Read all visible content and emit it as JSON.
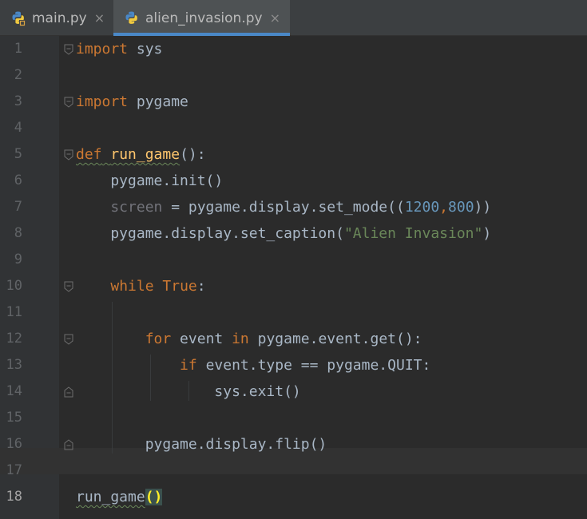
{
  "tabs": [
    {
      "label": "main.py",
      "close": "×",
      "icon": "python-file-icon",
      "active": false
    },
    {
      "label": "alien_invasion.py",
      "close": "×",
      "icon": "python-file-icon",
      "active": true
    }
  ],
  "colors": {
    "background": "#2b2b2b",
    "keyword": "#cc7832",
    "function": "#ffc66d",
    "number": "#6897bb",
    "string": "#6a8759",
    "default_text": "#a9b7c6",
    "active_tab_underline": "#4a88c7"
  },
  "current_line": 18,
  "lines": [
    {
      "num": "1",
      "tokens": [
        {
          "t": "kw",
          "v": "import"
        },
        {
          "t": "plain",
          "v": " sys"
        }
      ]
    },
    {
      "num": "2",
      "tokens": []
    },
    {
      "num": "3",
      "tokens": [
        {
          "t": "kw",
          "v": "import"
        },
        {
          "t": "plain",
          "v": " pygame"
        }
      ]
    },
    {
      "num": "4",
      "tokens": []
    },
    {
      "num": "5",
      "tokens": [
        {
          "t": "kw",
          "v": "def"
        },
        {
          "t": "plain",
          "v": " "
        },
        {
          "t": "fn",
          "v": "run_game"
        },
        {
          "t": "plain",
          "v": "():"
        }
      ]
    },
    {
      "num": "6",
      "tokens": [
        {
          "t": "plain",
          "v": "    pygame.init()"
        }
      ]
    },
    {
      "num": "7",
      "tokens": [
        {
          "t": "unused",
          "v": "    screen"
        },
        {
          "t": "plain",
          "v": " = pygame.display.set_mode(("
        },
        {
          "t": "num",
          "v": "1200"
        },
        {
          "t": "kw",
          "v": ","
        },
        {
          "t": "num",
          "v": "800"
        },
        {
          "t": "plain",
          "v": "))"
        }
      ]
    },
    {
      "num": "8",
      "tokens": [
        {
          "t": "plain",
          "v": "    pygame.display.set_caption("
        },
        {
          "t": "str",
          "v": "\"Alien Invasion\""
        },
        {
          "t": "plain",
          "v": ")"
        }
      ]
    },
    {
      "num": "9",
      "tokens": []
    },
    {
      "num": "10",
      "tokens": [
        {
          "t": "plain",
          "v": "    "
        },
        {
          "t": "kw",
          "v": "while"
        },
        {
          "t": "plain",
          "v": " "
        },
        {
          "t": "kw",
          "v": "True"
        },
        {
          "t": "plain",
          "v": ":"
        }
      ]
    },
    {
      "num": "11",
      "tokens": []
    },
    {
      "num": "12",
      "tokens": [
        {
          "t": "plain",
          "v": "        "
        },
        {
          "t": "kw",
          "v": "for"
        },
        {
          "t": "plain",
          "v": " event "
        },
        {
          "t": "kw",
          "v": "in"
        },
        {
          "t": "plain",
          "v": " pygame.event.get():"
        }
      ]
    },
    {
      "num": "13",
      "tokens": [
        {
          "t": "plain",
          "v": "            "
        },
        {
          "t": "kw",
          "v": "if"
        },
        {
          "t": "plain",
          "v": " event.type == pygame.QUIT:"
        }
      ]
    },
    {
      "num": "14",
      "tokens": [
        {
          "t": "plain",
          "v": "                sys.exit()"
        }
      ]
    },
    {
      "num": "15",
      "tokens": []
    },
    {
      "num": "16",
      "tokens": [
        {
          "t": "plain",
          "v": "        pygame.display.flip()"
        }
      ]
    },
    {
      "num": "17",
      "tokens": []
    },
    {
      "num": "18",
      "tokens": [
        {
          "t": "plain",
          "v": "run_game"
        },
        {
          "t": "brace",
          "v": "()"
        }
      ]
    }
  ]
}
